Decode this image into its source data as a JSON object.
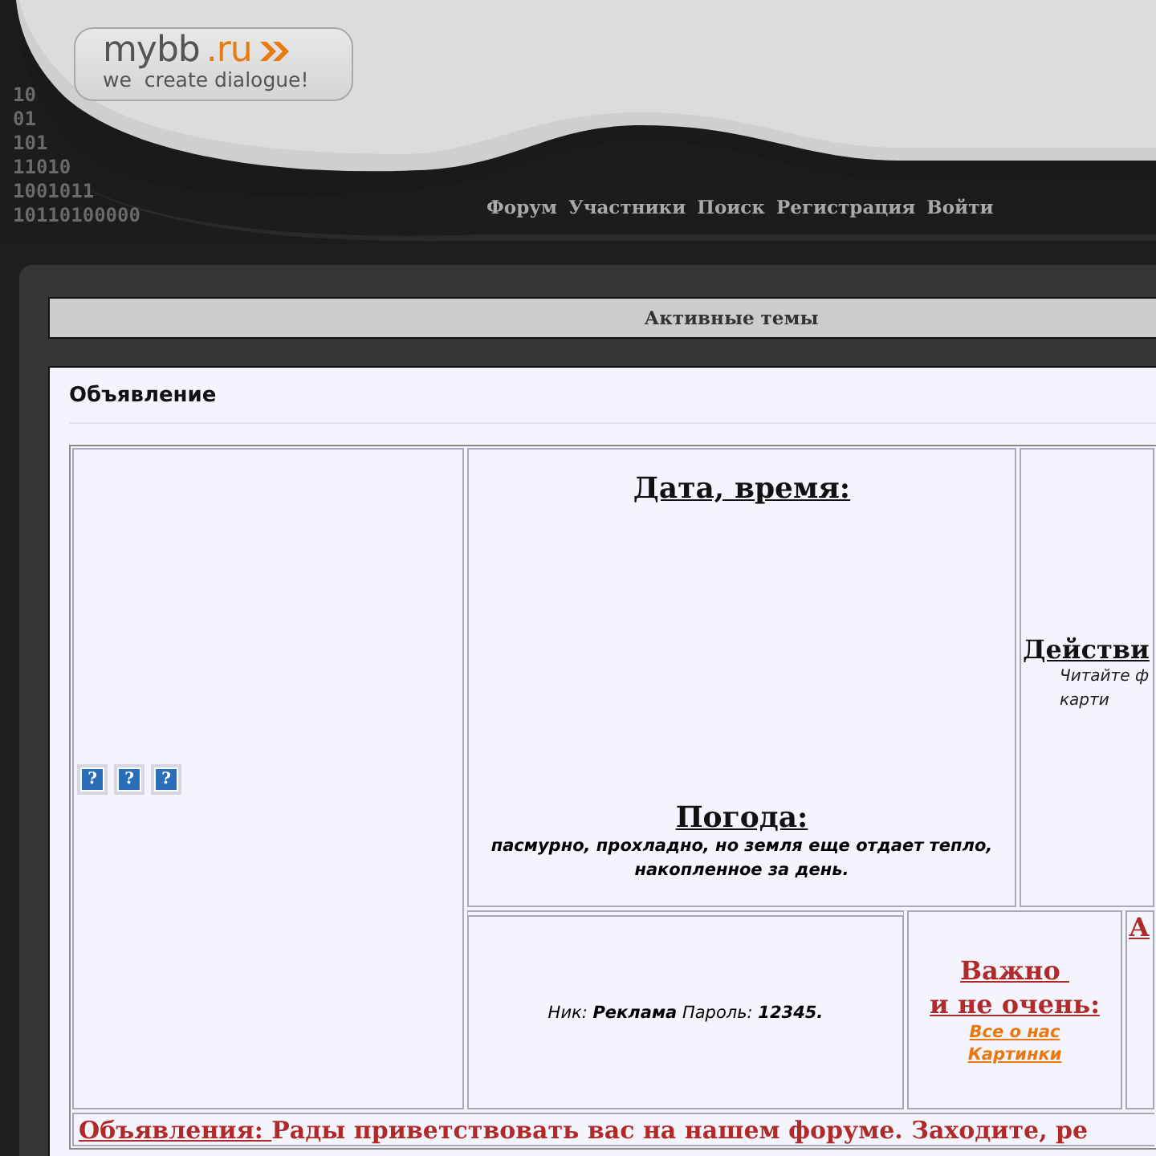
{
  "header": {
    "logo": {
      "name": "mybb",
      "domain": ".ru",
      "tagline": "we  create dialogue!"
    },
    "binary": [
      "10",
      "01",
      "101",
      "11010",
      "1001011",
      "10110100000"
    ],
    "nav": [
      "Форум",
      "Участники",
      "Поиск",
      "Регистрация",
      "Войти"
    ]
  },
  "active_topics": {
    "title": "Активные темы"
  },
  "announcement": {
    "title": "Объявление",
    "help_buttons": [
      {
        "label": "?"
      },
      {
        "label": "?"
      },
      {
        "label": "?"
      }
    ],
    "datetime": {
      "heading": "Дата, время:"
    },
    "weather": {
      "heading": "Погода:",
      "text": "пасмурно, прохладно, но земля еще отдает тепло, накопленное за день."
    },
    "actions": {
      "heading": "Действи",
      "lines": [
        "Читайте ф",
        "карти"
      ]
    },
    "login": "Ник: **Реклама** Пароль: **12345.**",
    "important": {
      "heading_lines": [
        "Важно ",
        "и не очень:"
      ],
      "links": [
        "Все о нас",
        "Картинки"
      ]
    },
    "cut_heading": "А",
    "notice": {
      "label": "Объявления: ",
      "text": "Рады приветствовать вас на нашем форуме. Заходите, ре"
    }
  }
}
